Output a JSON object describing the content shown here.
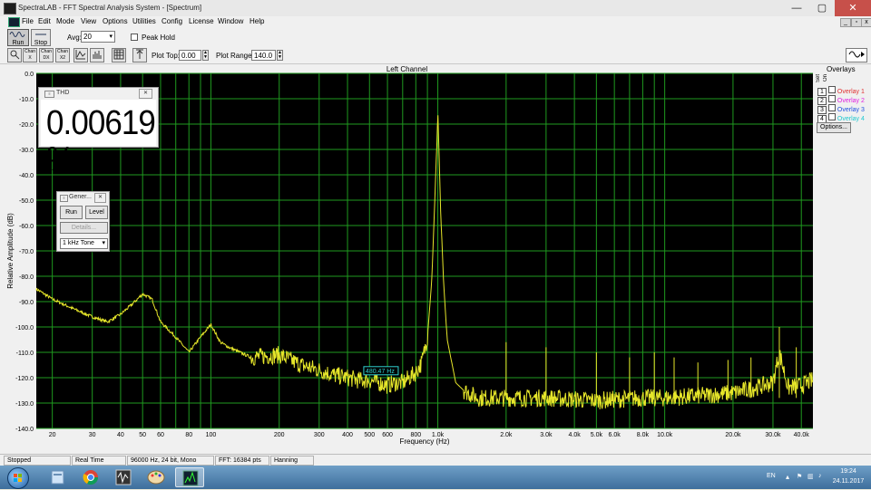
{
  "window": {
    "title": "SpectraLAB - FFT Spectral Analysis System - [Spectrum]",
    "controls": [
      "—",
      "▢",
      "✕"
    ],
    "mdi_controls": [
      "_",
      "▫",
      "x"
    ]
  },
  "menu": [
    "File",
    "Edit",
    "Mode",
    "View",
    "Options",
    "Utilities",
    "Config",
    "License",
    "Window",
    "Help"
  ],
  "toolbar": {
    "run_label": "Run",
    "stop_label": "Stop",
    "avg_label": "Avg:",
    "avg_value": "20",
    "peak_hold_label": "Peak Hold",
    "plot_top_label": "Plot Top:",
    "plot_top_value": "0.00",
    "plot_range_label": "Plot Range:",
    "plot_range_value": "140.0",
    "small_buttons": [
      "Chan",
      "Chan",
      "Chan"
    ],
    "small_button_subs": [
      "X",
      "DX",
      "X2"
    ]
  },
  "plot": {
    "channel_title": "Left Channel"
  },
  "overlays": {
    "title": "Overlays",
    "set_label": "Set",
    "on_label": "On",
    "items": [
      {
        "num": "1",
        "label": "Overlay 1",
        "color": "#e03030"
      },
      {
        "num": "2",
        "label": "Overlay 2",
        "color": "#e020e0"
      },
      {
        "num": "3",
        "label": "Overlay 3",
        "color": "#2050e0"
      },
      {
        "num": "4",
        "label": "Overlay 4",
        "color": "#20c8d0"
      }
    ],
    "options_label": "Options..."
  },
  "thd": {
    "title": "THD",
    "value": "0.00619 %",
    "close": "✕"
  },
  "generator": {
    "title": "Gener...",
    "close": "✕",
    "run_label": "Run",
    "level_label": "Level",
    "details_label": "Details...",
    "tone_value": "1 kHz Tone"
  },
  "status": {
    "state": "Stopped",
    "mode": "Real Time",
    "format": "96000 Hz, 24 bit, Mono",
    "fft": "FFT: 16384 pts",
    "window": "Hanning"
  },
  "tray": {
    "lang": "EN",
    "time": "19:24",
    "date": "24.11.2017"
  },
  "chart_data": {
    "type": "line",
    "title": "Left Channel",
    "xlabel": "Frequency (Hz)",
    "ylabel": "Relative Amplitude (dB)",
    "xscale": "log",
    "xlim": [
      17,
      45000
    ],
    "ylim": [
      -140,
      0
    ],
    "grid": true,
    "background": "#000000",
    "grid_color": "#1f9a1f",
    "line_color": "#e6e62a",
    "y_ticks": [
      0,
      -10,
      -20,
      -30,
      -40,
      -50,
      -60,
      -70,
      -80,
      -90,
      -100,
      -110,
      -120,
      -130,
      -140
    ],
    "y_tick_labels": [
      "0.0",
      "-10.0",
      "-20.0",
      "-30.0",
      "-40.0",
      "-50.0",
      "-60.0",
      "-70.0",
      "-80.0",
      "-90.0",
      "-100.0",
      "-110.0",
      "-120.0",
      "-130.0",
      "-140.0"
    ],
    "x_ticks": [
      20,
      30,
      40,
      50,
      60,
      80,
      100,
      200,
      300,
      400,
      500,
      600,
      800,
      1000,
      2000,
      3000,
      4000,
      5000,
      6000,
      8000,
      10000,
      20000,
      30000,
      40000
    ],
    "x_tick_labels": [
      "20",
      "30",
      "40",
      "50",
      "60",
      "80",
      "100",
      "200",
      "300",
      "400",
      "500",
      "600",
      "800",
      "1.0k",
      "2.0k",
      "3.0k",
      "4.0k",
      "5.0k",
      "6.0k",
      "8.0k",
      "10.0k",
      "20.0k",
      "30.0k",
      "40.0k"
    ],
    "cursor_label": "480.47 Hz",
    "cursor_freq": 480.47,
    "cursor_db": -121,
    "series": [
      {
        "x": [
          17,
          20,
          25,
          30,
          35,
          40,
          45,
          50,
          55,
          60,
          70,
          80,
          90,
          100,
          110,
          120,
          150,
          200,
          250,
          300,
          350,
          400,
          450,
          500,
          550,
          600,
          650,
          700,
          750,
          800,
          850,
          900,
          940,
          970,
          990,
          1000,
          1010,
          1030,
          1060,
          1100,
          1200,
          1300,
          1500,
          2000,
          3000,
          5000,
          8000,
          10000,
          15000,
          20000,
          25000,
          30000,
          32000,
          35000,
          40000,
          45000
        ],
        "y": [
          -85,
          -89,
          -93,
          -96,
          -98,
          -95,
          -91,
          -87,
          -89,
          -98,
          -104,
          -110,
          -104,
          -99,
          -106,
          -108,
          -112,
          -111,
          -115,
          -117,
          -119,
          -120,
          -121,
          -121,
          -122,
          -123,
          -122,
          -122,
          -120,
          -118,
          -114,
          -104,
          -82,
          -50,
          -28,
          -15,
          -28,
          -55,
          -82,
          -105,
          -122,
          -125,
          -128,
          -128,
          -128,
          -129,
          -128,
          -128,
          -127,
          -126,
          -124,
          -122,
          -110,
          -124,
          -123,
          -121
        ]
      }
    ],
    "spurs": [
      {
        "x": 2000,
        "y": -106
      },
      {
        "x": 3000,
        "y": -108
      },
      {
        "x": 5000,
        "y": -110
      },
      {
        "x": 7000,
        "y": -112
      },
      {
        "x": 9000,
        "y": -110
      },
      {
        "x": 11000,
        "y": -112
      },
      {
        "x": 14000,
        "y": -114
      },
      {
        "x": 19000,
        "y": -113
      },
      {
        "x": 24000,
        "y": -112
      },
      {
        "x": 32000,
        "y": -100
      },
      {
        "x": 38000,
        "y": -108
      }
    ]
  }
}
